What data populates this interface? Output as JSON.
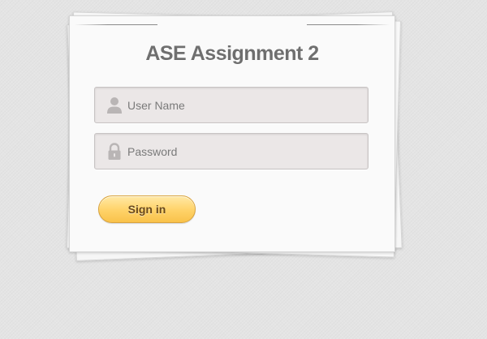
{
  "login_form": {
    "title": "ASE Assignment 2",
    "username": {
      "placeholder": "User Name",
      "value": "",
      "icon": "user-icon"
    },
    "password": {
      "placeholder": "Password",
      "value": "",
      "icon": "lock-icon"
    },
    "submit_label": "Sign in"
  },
  "colors": {
    "background": "#e4e4e4",
    "card": "#fafafa",
    "title_text": "#6f6f6f",
    "field_background": "#ebe7e7",
    "button_gradient_top": "#ffe9a6",
    "button_gradient_bottom": "#f9c24a",
    "button_text": "#6a4a1c"
  }
}
